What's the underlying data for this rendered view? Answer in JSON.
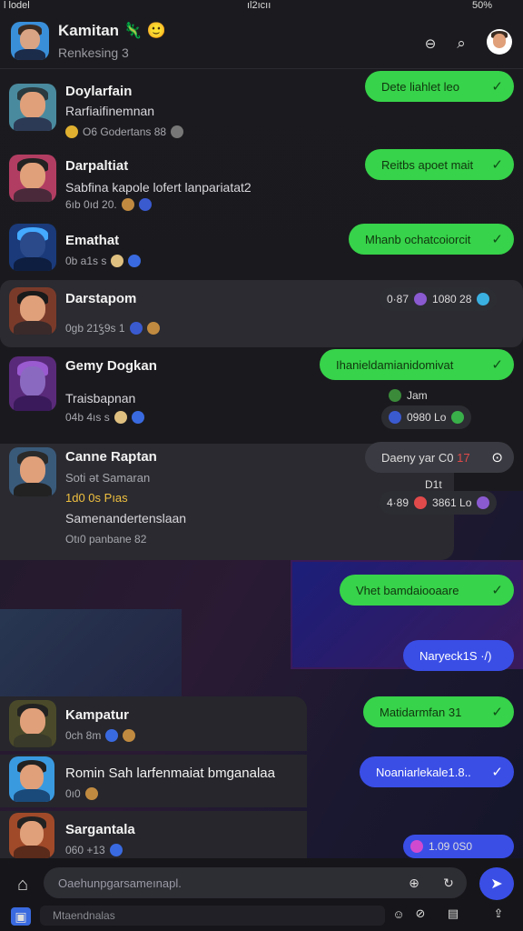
{
  "status": {
    "left": "l lodel",
    "time": "ıl2ıcıı",
    "battery": "50%"
  },
  "header": {
    "title": "Kamitan",
    "subtitle": "Renkesing  3",
    "title_emoji_1": "🦎",
    "title_emoji_2": "🙂"
  },
  "chats": [
    {
      "name": "Doylarfain",
      "sub": "Rarfiaifinemnan",
      "meta": "O6  Godertans  88",
      "bubble": "Dete liahlet leo"
    },
    {
      "name": "Darpaltiat",
      "sub": "Sabfina kapole lofert lanpariatat2",
      "meta": "6ıb  0ıd  20.",
      "bubble": "Reitbs apoet mait"
    },
    {
      "name": "Emathat",
      "sub": "",
      "meta": "0b  a1s  s",
      "bubble": "Mhanb ochatcoiorcit"
    },
    {
      "name": "Darstapom",
      "sub": "",
      "meta": "0gb  21ꝣ9s  1",
      "reaction_label": "0·87",
      "reaction_value": "1080 28"
    },
    {
      "name": "Gemy Dogkan",
      "sub": "Traisbapnan",
      "meta": "04b  4ıs  s",
      "bubble": "Ihanieldamianidomivat",
      "reaction_label": "Jam",
      "reaction_value": "0980 Lo"
    },
    {
      "name": "Canne Raptan",
      "sub": "Soti ət Samaran",
      "meta_line1": "1d0 0s Pıas",
      "sub2": "Samenandertenslaan",
      "meta": "Otı0 panbane 82",
      "bubble": "Daeny yar C0",
      "bubble_num": "17",
      "reaction_label": "4·89",
      "reaction_value": "3861 Lo",
      "dolt": "D1t"
    }
  ],
  "messages": {
    "m1": "Vhet bamdaiooaare",
    "m2": "Naryeck1S ·/)"
  },
  "chats2": [
    {
      "name": "Kampatur",
      "meta": "0ch  8m",
      "bubble": "Matidarmfan 31"
    },
    {
      "name": "Romin Sah larfenmaiat bmganalaa",
      "meta": "0ı0",
      "bubble": "Noaniarlekale1.8.."
    },
    {
      "name": "Sargantala",
      "meta": "060  +13",
      "reaction_value": "1.09 0S0"
    }
  ],
  "composer": {
    "placeholder": "Oaehunpgarsameınapl.",
    "bottom": "Mtaendnalas"
  },
  "colors": {
    "green": "#37d34a",
    "blue": "#3a4ee6",
    "bg": "#1b1b1f"
  }
}
